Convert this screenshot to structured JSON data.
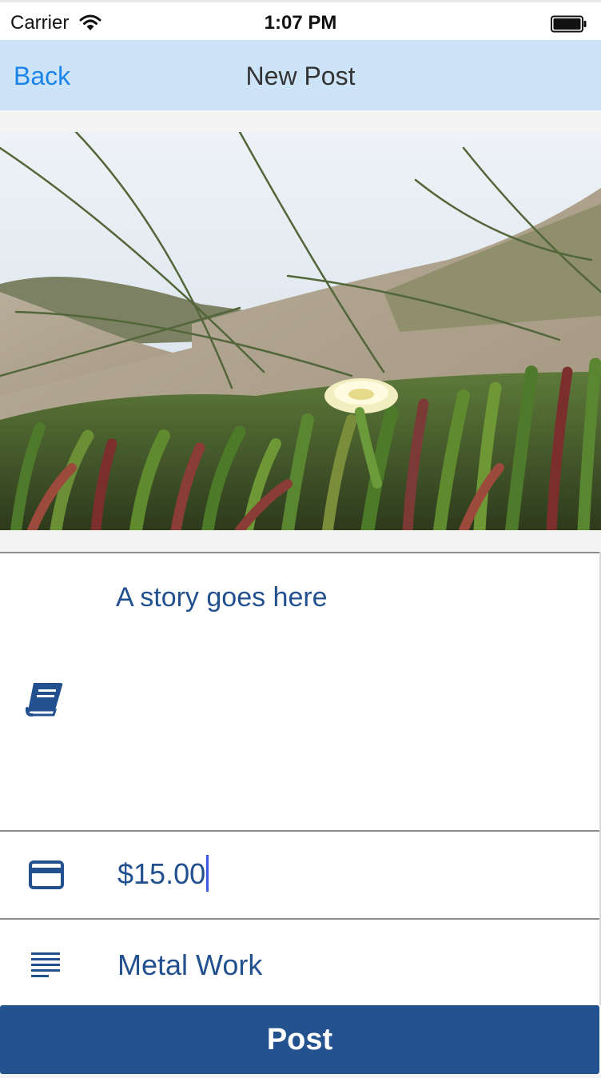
{
  "status_bar": {
    "carrier": "Carrier",
    "time": "1:07 PM",
    "wifi_icon": "wifi-icon",
    "battery_icon": "battery-full-icon"
  },
  "nav": {
    "back_label": "Back",
    "title": "New Post"
  },
  "photo": {
    "subject": "succulent ground cover with a pale yellow flower on a sandy dune"
  },
  "form": {
    "story": {
      "icon": "book-icon",
      "value": "A story goes here"
    },
    "price": {
      "icon": "credit-card-icon",
      "value": "$15.00"
    },
    "category": {
      "icon": "text-lines-icon",
      "value": "Metal Work"
    }
  },
  "post_button_label": "Post",
  "colors": {
    "nav_background": "#cde4f8",
    "link": "#1a84e8",
    "field_text": "#23508f",
    "post_button": "#23528f"
  }
}
